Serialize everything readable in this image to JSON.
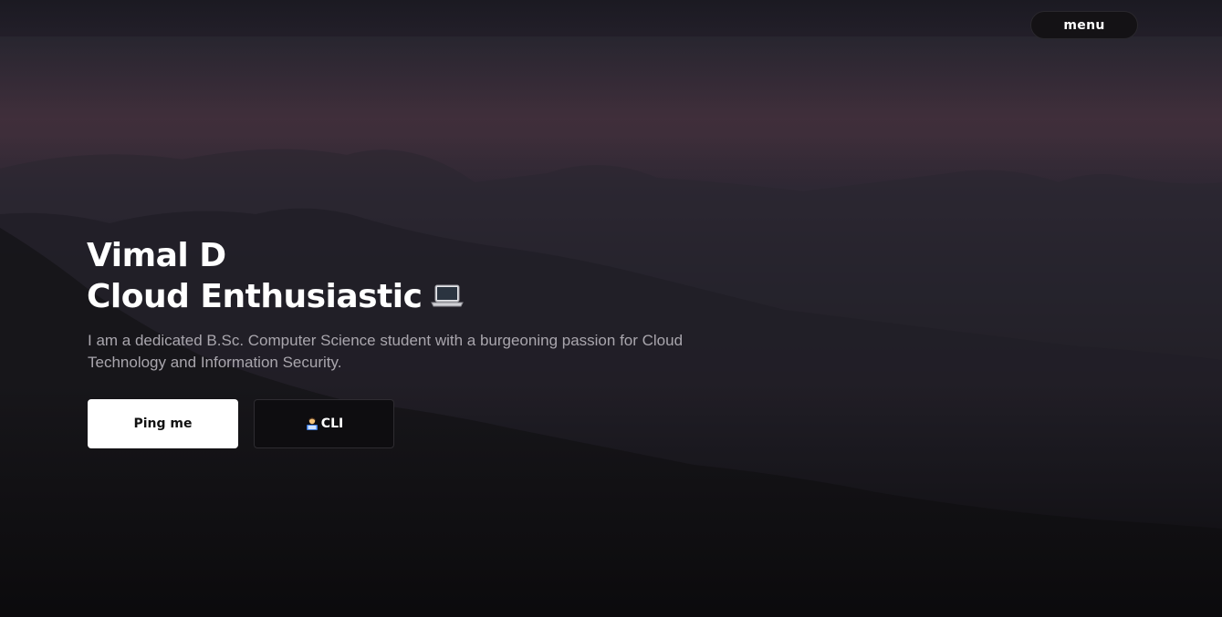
{
  "header": {
    "menu_label": "menu"
  },
  "hero": {
    "name": "Vimal D",
    "tagline": "Cloud Enthusiastic",
    "tagline_icon": "laptop-icon",
    "description": "I am a dedicated B.Sc. Computer Science student with a burgeoning passion for Cloud Technology and Information Security."
  },
  "actions": {
    "ping_label": "Ping me",
    "cli_label": "CLI",
    "cli_icon": "technologist-icon"
  },
  "colors": {
    "background": "#0c0a0d",
    "primary_button_bg": "#ffffff",
    "secondary_button_bg": "#0e0d10",
    "text_primary": "#ffffff",
    "text_muted": "#a9a6ad"
  }
}
